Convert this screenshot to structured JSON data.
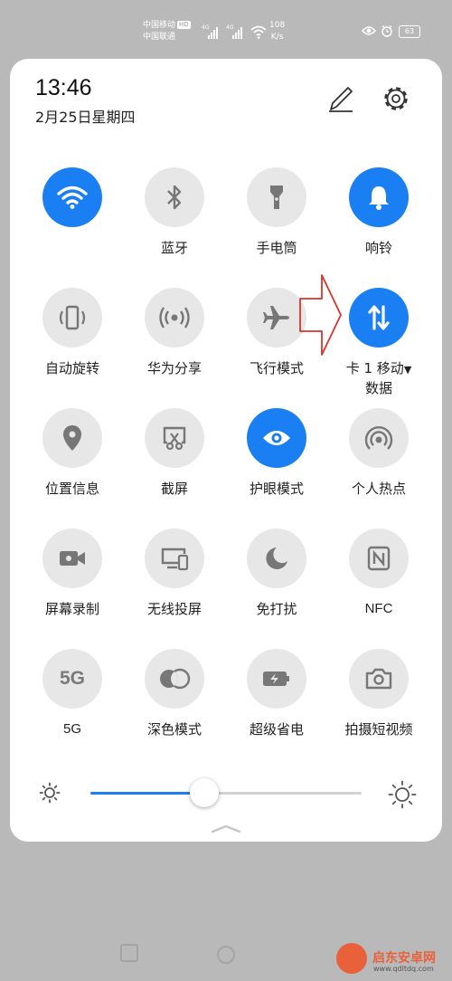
{
  "status_bar": {
    "carrier1": "中国移动",
    "carrier1_badge": "HD",
    "carrier2": "中国联通",
    "speed_value": "108",
    "speed_unit": "K/s",
    "battery": "63"
  },
  "panel": {
    "time": "13:46",
    "date": "2月25日星期四"
  },
  "tiles": [
    {
      "label": "",
      "icon": "wifi-icon",
      "active": true
    },
    {
      "label": "蓝牙",
      "icon": "bluetooth-icon",
      "active": false
    },
    {
      "label": "手电筒",
      "icon": "flashlight-icon",
      "active": false
    },
    {
      "label": "响铃",
      "icon": "bell-icon",
      "active": true
    },
    {
      "label": "自动旋转",
      "icon": "auto-rotate-icon",
      "active": false
    },
    {
      "label": "华为分享",
      "icon": "huawei-share-icon",
      "active": false
    },
    {
      "label": "飞行模式",
      "icon": "airplane-icon",
      "active": false
    },
    {
      "label": "卡 1 移动",
      "label2": "数据",
      "icon": "mobile-data-icon",
      "active": true
    },
    {
      "label": "位置信息",
      "icon": "location-icon",
      "active": false
    },
    {
      "label": "截屏",
      "icon": "screenshot-icon",
      "active": false
    },
    {
      "label": "护眼模式",
      "icon": "eye-comfort-icon",
      "active": true
    },
    {
      "label": "个人热点",
      "icon": "hotspot-icon",
      "active": false
    },
    {
      "label": "屏幕录制",
      "icon": "screen-record-icon",
      "active": false
    },
    {
      "label": "无线投屏",
      "icon": "wireless-projection-icon",
      "active": false
    },
    {
      "label": "免打扰",
      "icon": "moon-icon",
      "active": false
    },
    {
      "label": "NFC",
      "icon": "nfc-icon",
      "active": false
    },
    {
      "label": "5G",
      "icon": "5g-icon",
      "icon_text": "5G",
      "active": false
    },
    {
      "label": "深色模式",
      "icon": "dark-mode-icon",
      "active": false
    },
    {
      "label": "超级省电",
      "icon": "battery-saver-icon",
      "active": false
    },
    {
      "label": "拍摄短视频",
      "icon": "camera-icon",
      "active": false
    }
  ],
  "brightness": {
    "level_fraction": 0.42
  },
  "colors": {
    "accent": "#1a7ff2",
    "tile_inactive": "#e7e7e7",
    "annotation_arrow": "#d9342b"
  },
  "watermark": {
    "main": "启东安卓网",
    "url": "www.qdltdq.com"
  }
}
